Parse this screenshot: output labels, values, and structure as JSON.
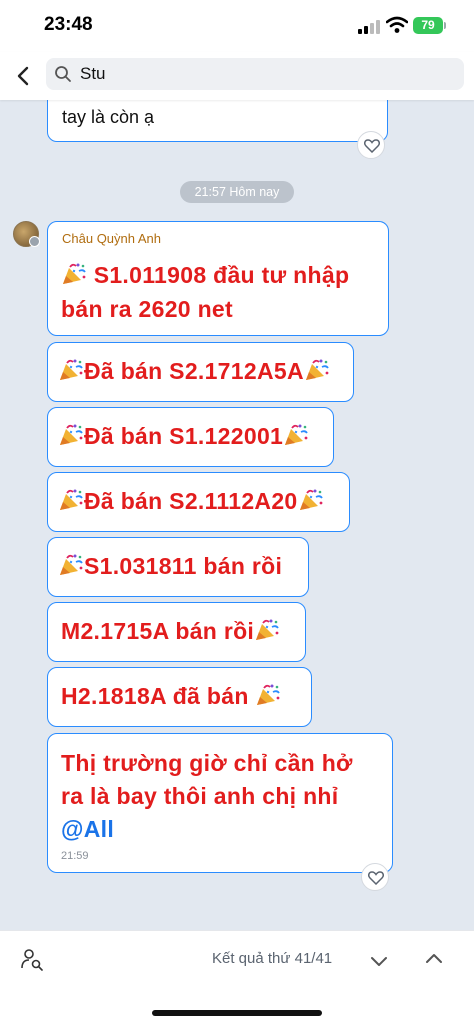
{
  "status_bar": {
    "time": "23:48",
    "battery": "79"
  },
  "header": {
    "search_value": "Stu"
  },
  "chat": {
    "prev_message_tail": "tay là còn ạ",
    "time_divider": "21:57 Hôm nay",
    "sender": "Châu Quỳnh Anh",
    "messages": [
      {
        "line1": "S1.011908 đầu tư nhập",
        "line2": "bán ra 2620 net"
      },
      {
        "text": "Đã bán S2.1712A5A"
      },
      {
        "text": "Đã bán S1.122001"
      },
      {
        "text": "Đã bán S2.1112A20"
      },
      {
        "text": "S1.031811 bán rồi"
      },
      {
        "text": "M2.1715A bán rồi"
      },
      {
        "text": "H2.1818A đã bán"
      },
      {
        "line1": "Thị trường giờ chỉ cần hở",
        "line2": "ra là bay thôi anh chị nhỉ",
        "mention": "@All",
        "time": "21:59"
      }
    ]
  },
  "bottom": {
    "result_text": "Kết quả thứ 41/41"
  },
  "colors": {
    "accent": "#2a8cff",
    "message_red": "#e21d1d",
    "sender": "#b06d10",
    "battery": "#34c759"
  },
  "icons": [
    "back-icon",
    "search-icon",
    "heart-icon",
    "party-popper-icon",
    "person-search-icon",
    "chevron-down-icon",
    "chevron-up-icon"
  ]
}
